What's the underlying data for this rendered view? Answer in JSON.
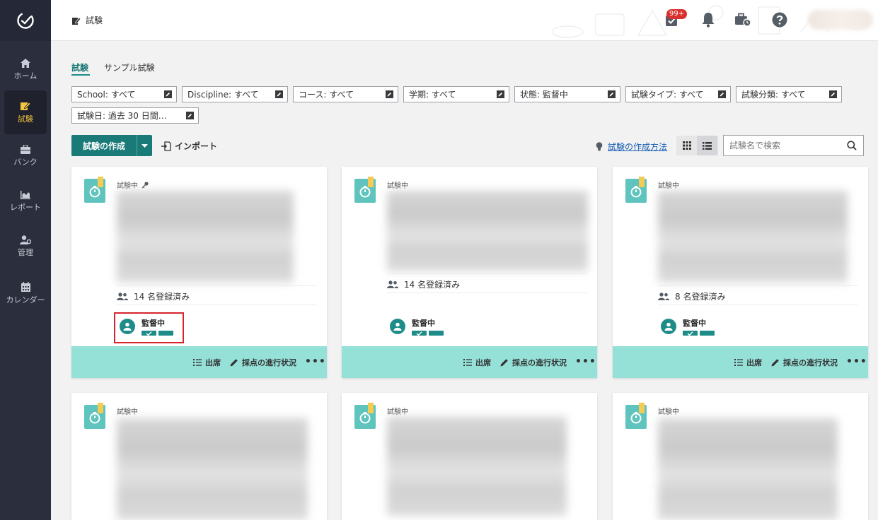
{
  "sidebar": {
    "items": [
      {
        "label": "ホーム",
        "icon": "home-icon"
      },
      {
        "label": "試験",
        "icon": "exam-icon"
      },
      {
        "label": "バンク",
        "icon": "bank-icon"
      },
      {
        "label": "レポート",
        "icon": "report-icon"
      },
      {
        "label": "管理",
        "icon": "admin-icon"
      },
      {
        "label": "カレンダー",
        "icon": "calendar-icon"
      }
    ]
  },
  "header": {
    "title": "試験",
    "badge": "99+"
  },
  "tabs": [
    "試験",
    "サンプル試験"
  ],
  "filters": [
    "School: すべて",
    "Discipline: すべて",
    "コース: すべて",
    "学期: すべて",
    "状態: 監督中",
    "試験タイプ: すべて",
    "試験分類: すべて",
    "試験日: 過去 30 日間…"
  ],
  "toolbar": {
    "create_label": "試験の作成",
    "import_label": "インポート",
    "howto_label": "試験の作成方法",
    "search_placeholder": "試験名で検索"
  },
  "cards": [
    {
      "status": "試験中",
      "enrolled": "14 名登録済み",
      "proctor": "監督中"
    },
    {
      "status": "試験中",
      "enrolled": "14 名登録済み",
      "proctor": "監督中"
    },
    {
      "status": "試験中",
      "enrolled": "8 名登録済み",
      "proctor": "監督中"
    },
    {
      "status": "試験中"
    },
    {
      "status": "試験中"
    },
    {
      "status": "試験中"
    }
  ],
  "card_actions": {
    "attendance": "出席",
    "grading": "採点の進行状況",
    "more": "•••"
  },
  "colors": {
    "sidebar": "#2b2e3c",
    "accent": "#1a7a78",
    "card_footer": "#95e1d8",
    "active_nav": "#f4c542",
    "highlight": "#d4252b"
  }
}
